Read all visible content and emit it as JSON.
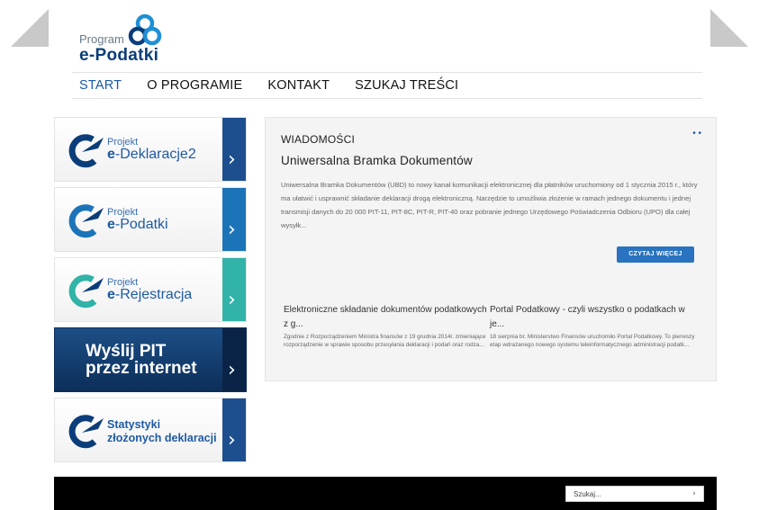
{
  "logo": {
    "program": "Program",
    "name": "e-Podatki"
  },
  "nav": [
    {
      "label": "START"
    },
    {
      "label": "O PROGRAMIE"
    },
    {
      "label": "KONTAKT"
    },
    {
      "label": "SZUKAJ TREŚCI"
    }
  ],
  "tiles": {
    "deklaracje": {
      "project": "Projekt",
      "prefix": "e",
      "name": "-Deklaracje2",
      "color": "#1d4f8f"
    },
    "podatki": {
      "project": "Projekt",
      "prefix": "e",
      "name": "-Podatki",
      "color": "#1c74b8"
    },
    "rejestracja": {
      "project": "Projekt",
      "prefix": "e",
      "name": "-Rejestracja",
      "color": "#31b3a7"
    },
    "pit": {
      "line1": "Wyślij PIT",
      "line2": "przez internet",
      "color": "#0a2448"
    },
    "statystyki": {
      "line1": "Statystyki",
      "line2": "złożonych deklaracji",
      "color": "#1d4f8f"
    }
  },
  "news": {
    "heading": "WIADOMOŚCI",
    "dots": "• •",
    "title": "Uniwersalna Bramka Dokumentów",
    "body": "Uniwersalna Bramka Dokumentów (UBD) to nowy kanał komunikacji elektronicznej dla płatników uruchomiony od 1 stycznia 2015 r., który ma ułatwić i usprawnić składanie deklaracji drogą elektroniczną. Narzędzie to umożliwia złożenie w ramach jednego dokumentu i jednej transmisji danych do 20 000 PIT-11, PIT-8C, PIT-R, PIT-40 oraz pobranie jednego Urzędowego Poświadczenia Odbioru (UPO) dla całej wysyłk...",
    "read_more": "CZYTAJ WIĘCEJ",
    "items": [
      {
        "title": "Elektroniczne składanie dokumentów podatkowych z g...",
        "body": "Zgodnie z Rozporządzeniem Ministra finansów z 19 grudnia 2014r. zmieniające rozporządzenie w sprawie sposobu przesyłania deklaracji i podań oraz rodza..."
      },
      {
        "title": "Portal Podatkowy - czyli wszystko o podatkach w je...",
        "body": "18 sierpnia br. Ministerstwo Finansów uruchomiło Portal Podatkowy. To pierwszy etap wdrażanego nowego systemu teleinformatycznego administracji podatk..."
      }
    ]
  },
  "footer": {
    "search_placeholder": "Szukaj...",
    "search_icon": "chevron-right-icon"
  },
  "colors": {
    "brand": "#0a3d79",
    "nav_active": "#1a5aa8",
    "button": "#2a73c0"
  }
}
